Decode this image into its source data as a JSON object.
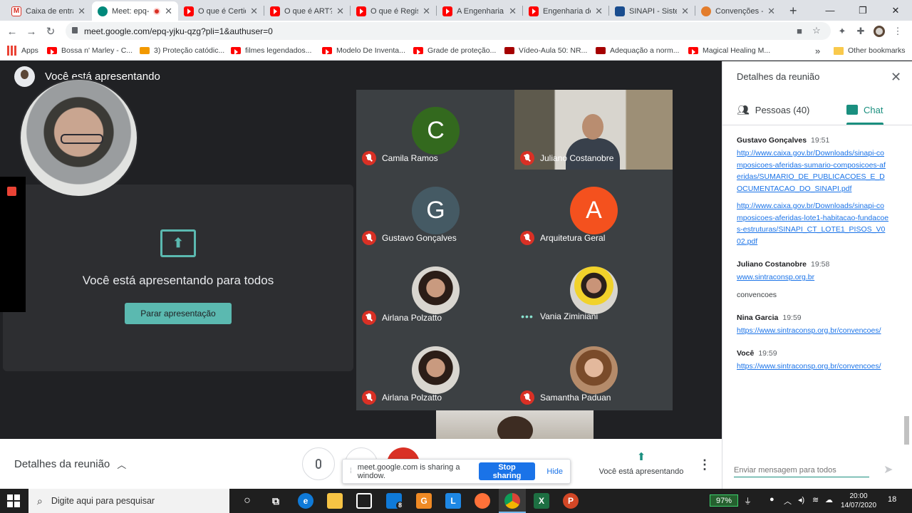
{
  "browser": {
    "tabs": [
      {
        "label": "Caixa de entrad",
        "favicon": "gmail-icon",
        "active": false
      },
      {
        "label": "Meet: epq-",
        "favicon": "meet-icon",
        "active": true
      },
      {
        "label": "O que é Certid",
        "favicon": "youtube-icon",
        "active": false
      },
      {
        "label": "O que é ART? -",
        "favicon": "youtube-icon",
        "active": false
      },
      {
        "label": "O que é Regist",
        "favicon": "youtube-icon",
        "active": false
      },
      {
        "label": "A Engenharia n",
        "favicon": "youtube-icon",
        "active": false
      },
      {
        "label": "Engenharia do",
        "favicon": "youtube-icon",
        "active": false
      },
      {
        "label": "SINAPI - Sistem",
        "favicon": "sinapi-icon",
        "active": false
      },
      {
        "label": "Convenções - S",
        "favicon": "sintracon-icon",
        "active": false
      }
    ],
    "new_tab": "+",
    "url": "meet.google.com/epq-yjku-qzg?pli=1&authuser=0",
    "bookmarks": [
      {
        "label": "Apps"
      },
      {
        "label": "Bossa n' Marley - C..."
      },
      {
        "label": "3) Proteção catódic..."
      },
      {
        "label": "filmes legendados..."
      },
      {
        "label": "Modelo De Inventa..."
      },
      {
        "label": "Grade de proteção..."
      },
      {
        "label": "Vídeo-Aula 50: NR..."
      },
      {
        "label": "Adequação a norm..."
      },
      {
        "label": "Magical Healing M..."
      }
    ],
    "bookmarks_overflow": "»",
    "other_bookmarks": "Other bookmarks"
  },
  "meet": {
    "presenting_header": "Você está apresentando",
    "present_panel_text": "Você está apresentando para todos",
    "stop_presenting": "Parar apresentação",
    "participants": [
      {
        "name": "Camila Ramos",
        "initial": "C",
        "color": "#33691e",
        "status": "muted"
      },
      {
        "name": "Juliano Costanobre",
        "initial": "",
        "color": "",
        "status": "muted"
      },
      {
        "name": "Gustavo Gonçalves",
        "initial": "G",
        "color": "#455a64",
        "status": "muted"
      },
      {
        "name": "Arquitetura Geral",
        "initial": "A",
        "color": "#f4511e",
        "status": "muted"
      },
      {
        "name": "Airlana Polzatto",
        "initial": "",
        "color": "",
        "status": "muted"
      },
      {
        "name": "Vania Ziminiani",
        "initial": "",
        "color": "",
        "status": "speaking"
      },
      {
        "name": "Airlana Polzatto",
        "initial": "",
        "color": "",
        "status": "muted"
      },
      {
        "name": "Samantha Paduan",
        "initial": "",
        "color": "",
        "status": "muted"
      }
    ],
    "bottom_bar": {
      "details_label": "Detalhes da reunião",
      "presenting_label": "Você está apresentando"
    },
    "share_notice": {
      "text": "meet.google.com is sharing a window.",
      "stop": "Stop sharing",
      "hide": "Hide"
    }
  },
  "side_panel": {
    "title": "Detalhes da reunião",
    "people_tab": "Pessoas (40)",
    "chat_tab": "Chat",
    "messages": [
      {
        "sender": "Gustavo Gonçalves",
        "time": "19:51",
        "links": [
          "http://www.caixa.gov.br/Downloads/sinapi-composicoes-aferidas-sumario-composicoes-aferidas/SUMARIO_DE_PUBLICACOES_E_DOCUMENTACAO_DO_SINAPI.pdf",
          "http://www.caixa.gov.br/Downloads/sinapi-composicoes-aferidas-lote1-habitacao-fundacoes-estruturas/SINAPI_CT_LOTE1_PISOS_V002.pdf"
        ],
        "text": ""
      },
      {
        "sender": "Juliano Costanobre",
        "time": "19:58",
        "links": [
          "www.sintraconsp.org.br"
        ],
        "text": "convencoes"
      },
      {
        "sender": "Nina Garcia",
        "time": "19:59",
        "links": [
          "https://www.sintraconsp.org.br/convencoes/"
        ],
        "text": ""
      },
      {
        "sender": "Você",
        "time": "19:59",
        "links": [
          "https://www.sintraconsp.org.br/convencoes/"
        ],
        "text": ""
      }
    ],
    "input_placeholder": "Enviar mensagem para todos"
  },
  "taskbar": {
    "search_placeholder": "Digite aqui para pesquisar",
    "battery": "97%",
    "time": "20:00",
    "date": "14/07/2020",
    "mail_badge": "8",
    "notifications": "18"
  }
}
